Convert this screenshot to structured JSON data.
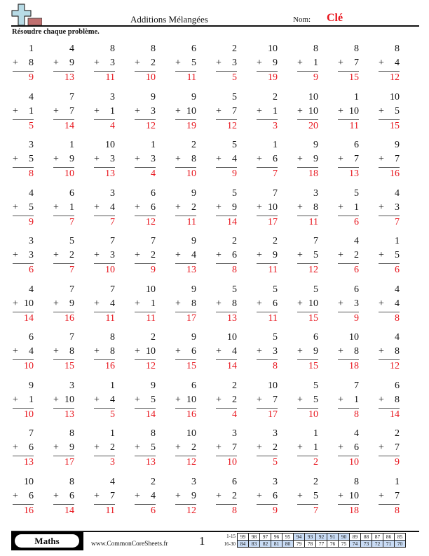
{
  "header": {
    "logo_icon": "plus-sign-logo-icon",
    "title": "Additions Mélangées",
    "name_label": "Nom:",
    "name_value": "Clé",
    "instructions": "Résoudre chaque problème."
  },
  "colors": {
    "answer": "#e8141c",
    "logo_plus": "#b7dbe6",
    "logo_bar": "#c07070",
    "score_highlight": "#c9dcf5"
  },
  "problems": [
    [
      {
        "a": "1",
        "b": "8",
        "ans": "9"
      },
      {
        "a": "4",
        "b": "9",
        "ans": "13"
      },
      {
        "a": "8",
        "b": "3",
        "ans": "11"
      },
      {
        "a": "8",
        "b": "2",
        "ans": "10"
      },
      {
        "a": "6",
        "b": "5",
        "ans": "11"
      },
      {
        "a": "2",
        "b": "3",
        "ans": "5"
      },
      {
        "a": "10",
        "b": "9",
        "ans": "19"
      },
      {
        "a": "8",
        "b": "1",
        "ans": "9"
      },
      {
        "a": "8",
        "b": "7",
        "ans": "15"
      },
      {
        "a": "8",
        "b": "4",
        "ans": "12"
      }
    ],
    [
      {
        "a": "4",
        "b": "1",
        "ans": "5"
      },
      {
        "a": "7",
        "b": "7",
        "ans": "14"
      },
      {
        "a": "3",
        "b": "1",
        "ans": "4"
      },
      {
        "a": "9",
        "b": "3",
        "ans": "12"
      },
      {
        "a": "9",
        "b": "10",
        "ans": "19"
      },
      {
        "a": "5",
        "b": "7",
        "ans": "12"
      },
      {
        "a": "2",
        "b": "1",
        "ans": "3"
      },
      {
        "a": "10",
        "b": "10",
        "ans": "20"
      },
      {
        "a": "1",
        "b": "10",
        "ans": "11"
      },
      {
        "a": "10",
        "b": "5",
        "ans": "15"
      }
    ],
    [
      {
        "a": "3",
        "b": "5",
        "ans": "8"
      },
      {
        "a": "1",
        "b": "9",
        "ans": "10"
      },
      {
        "a": "10",
        "b": "3",
        "ans": "13"
      },
      {
        "a": "1",
        "b": "3",
        "ans": "4"
      },
      {
        "a": "2",
        "b": "8",
        "ans": "10"
      },
      {
        "a": "5",
        "b": "4",
        "ans": "9"
      },
      {
        "a": "1",
        "b": "6",
        "ans": "7"
      },
      {
        "a": "9",
        "b": "9",
        "ans": "18"
      },
      {
        "a": "6",
        "b": "7",
        "ans": "13"
      },
      {
        "a": "9",
        "b": "7",
        "ans": "16"
      }
    ],
    [
      {
        "a": "4",
        "b": "5",
        "ans": "9"
      },
      {
        "a": "6",
        "b": "1",
        "ans": "7"
      },
      {
        "a": "3",
        "b": "4",
        "ans": "7"
      },
      {
        "a": "6",
        "b": "6",
        "ans": "12"
      },
      {
        "a": "9",
        "b": "2",
        "ans": "11"
      },
      {
        "a": "5",
        "b": "9",
        "ans": "14"
      },
      {
        "a": "7",
        "b": "10",
        "ans": "17"
      },
      {
        "a": "3",
        "b": "8",
        "ans": "11"
      },
      {
        "a": "5",
        "b": "1",
        "ans": "6"
      },
      {
        "a": "4",
        "b": "3",
        "ans": "7"
      }
    ],
    [
      {
        "a": "3",
        "b": "3",
        "ans": "6"
      },
      {
        "a": "5",
        "b": "2",
        "ans": "7"
      },
      {
        "a": "7",
        "b": "3",
        "ans": "10"
      },
      {
        "a": "7",
        "b": "2",
        "ans": "9"
      },
      {
        "a": "9",
        "b": "4",
        "ans": "13"
      },
      {
        "a": "2",
        "b": "6",
        "ans": "8"
      },
      {
        "a": "2",
        "b": "9",
        "ans": "11"
      },
      {
        "a": "7",
        "b": "5",
        "ans": "12"
      },
      {
        "a": "4",
        "b": "2",
        "ans": "6"
      },
      {
        "a": "1",
        "b": "5",
        "ans": "6"
      }
    ],
    [
      {
        "a": "4",
        "b": "10",
        "ans": "14"
      },
      {
        "a": "7",
        "b": "9",
        "ans": "16"
      },
      {
        "a": "7",
        "b": "4",
        "ans": "11"
      },
      {
        "a": "10",
        "b": "1",
        "ans": "11"
      },
      {
        "a": "9",
        "b": "8",
        "ans": "17"
      },
      {
        "a": "5",
        "b": "8",
        "ans": "13"
      },
      {
        "a": "5",
        "b": "6",
        "ans": "11"
      },
      {
        "a": "5",
        "b": "10",
        "ans": "15"
      },
      {
        "a": "6",
        "b": "3",
        "ans": "9"
      },
      {
        "a": "4",
        "b": "4",
        "ans": "8"
      }
    ],
    [
      {
        "a": "6",
        "b": "4",
        "ans": "10"
      },
      {
        "a": "7",
        "b": "8",
        "ans": "15"
      },
      {
        "a": "8",
        "b": "8",
        "ans": "16"
      },
      {
        "a": "2",
        "b": "10",
        "ans": "12"
      },
      {
        "a": "9",
        "b": "6",
        "ans": "15"
      },
      {
        "a": "10",
        "b": "4",
        "ans": "14"
      },
      {
        "a": "5",
        "b": "3",
        "ans": "8"
      },
      {
        "a": "6",
        "b": "9",
        "ans": "15"
      },
      {
        "a": "10",
        "b": "8",
        "ans": "18"
      },
      {
        "a": "4",
        "b": "8",
        "ans": "12"
      }
    ],
    [
      {
        "a": "9",
        "b": "1",
        "ans": "10"
      },
      {
        "a": "3",
        "b": "10",
        "ans": "13"
      },
      {
        "a": "1",
        "b": "4",
        "ans": "5"
      },
      {
        "a": "9",
        "b": "5",
        "ans": "14"
      },
      {
        "a": "6",
        "b": "10",
        "ans": "16"
      },
      {
        "a": "2",
        "b": "2",
        "ans": "4"
      },
      {
        "a": "10",
        "b": "7",
        "ans": "17"
      },
      {
        "a": "5",
        "b": "5",
        "ans": "10"
      },
      {
        "a": "7",
        "b": "1",
        "ans": "8"
      },
      {
        "a": "6",
        "b": "8",
        "ans": "14"
      }
    ],
    [
      {
        "a": "7",
        "b": "6",
        "ans": "13"
      },
      {
        "a": "8",
        "b": "9",
        "ans": "17"
      },
      {
        "a": "1",
        "b": "2",
        "ans": "3"
      },
      {
        "a": "8",
        "b": "5",
        "ans": "13"
      },
      {
        "a": "10",
        "b": "2",
        "ans": "12"
      },
      {
        "a": "3",
        "b": "7",
        "ans": "10"
      },
      {
        "a": "3",
        "b": "2",
        "ans": "5"
      },
      {
        "a": "1",
        "b": "1",
        "ans": "2"
      },
      {
        "a": "4",
        "b": "6",
        "ans": "10"
      },
      {
        "a": "2",
        "b": "7",
        "ans": "9"
      }
    ],
    [
      {
        "a": "10",
        "b": "6",
        "ans": "16"
      },
      {
        "a": "8",
        "b": "6",
        "ans": "14"
      },
      {
        "a": "4",
        "b": "7",
        "ans": "11"
      },
      {
        "a": "2",
        "b": "4",
        "ans": "6"
      },
      {
        "a": "3",
        "b": "9",
        "ans": "12"
      },
      {
        "a": "6",
        "b": "2",
        "ans": "8"
      },
      {
        "a": "3",
        "b": "6",
        "ans": "9"
      },
      {
        "a": "2",
        "b": "5",
        "ans": "7"
      },
      {
        "a": "8",
        "b": "10",
        "ans": "18"
      },
      {
        "a": "1",
        "b": "7",
        "ans": "8"
      }
    ]
  ],
  "operator": "+",
  "footer": {
    "subject": "Maths",
    "website": "www.CommonCoreSheets.fr",
    "page_number": "1",
    "score_rows": [
      {
        "label": "1-15",
        "scores": [
          "99",
          "98",
          "97",
          "96",
          "95",
          "94",
          "93",
          "92",
          "91",
          "90",
          "89",
          "88",
          "87",
          "86",
          "85"
        ],
        "highlight": [
          false,
          false,
          false,
          false,
          false,
          true,
          true,
          true,
          true,
          true,
          false,
          false,
          false,
          false,
          false
        ]
      },
      {
        "label": "16-30",
        "scores": [
          "84",
          "83",
          "82",
          "81",
          "80",
          "79",
          "78",
          "77",
          "76",
          "75",
          "74",
          "73",
          "72",
          "71",
          "70"
        ],
        "highlight": [
          true,
          true,
          true,
          true,
          true,
          false,
          false,
          false,
          false,
          false,
          true,
          true,
          true,
          true,
          true
        ]
      }
    ]
  }
}
